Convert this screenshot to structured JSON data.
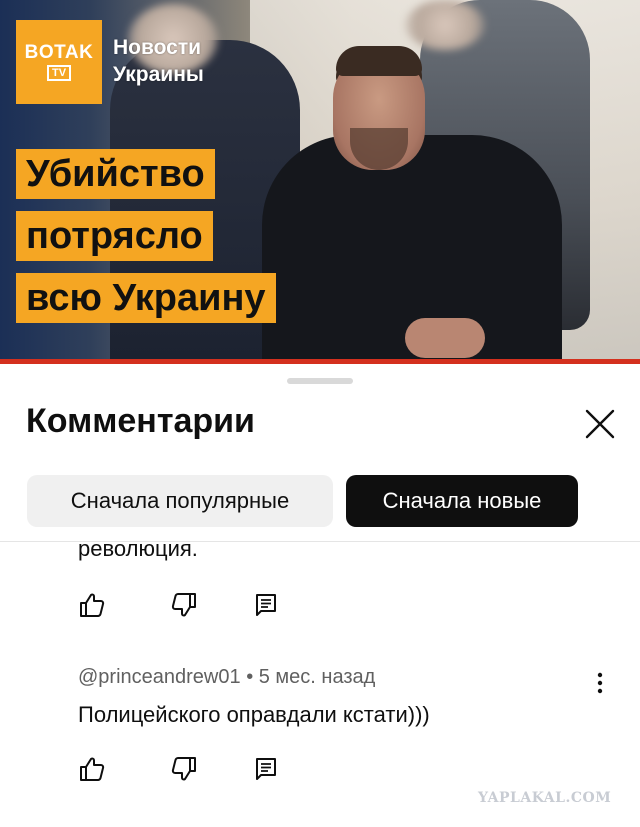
{
  "video": {
    "logo_line1": "BOTAK",
    "logo_line2": "TV",
    "channel_line1": "Новости",
    "channel_line2": "Украины",
    "headline": [
      "Убийство",
      "потрясло",
      "всю Украину"
    ],
    "accent_color": "#f5a623",
    "progress_color": "#d4301e"
  },
  "comments_panel": {
    "title": "Комментарии",
    "close_icon": "close-icon",
    "sort_chips": [
      {
        "label": "Сначала популярные",
        "selected": false
      },
      {
        "label": "Сначала новые",
        "selected": true
      }
    ],
    "comments": [
      {
        "text": "революция.",
        "actions": [
          "like-icon",
          "dislike-icon",
          "reply-icon"
        ]
      },
      {
        "author": "@princeandrew01",
        "time": "5 мес. назад",
        "text": "Полицейского оправдали  кстати)))",
        "actions": [
          "like-icon",
          "dislike-icon",
          "reply-icon"
        ],
        "menu_icon": "more-vert-icon"
      }
    ]
  },
  "watermark": "YAPLAKAL.COM"
}
